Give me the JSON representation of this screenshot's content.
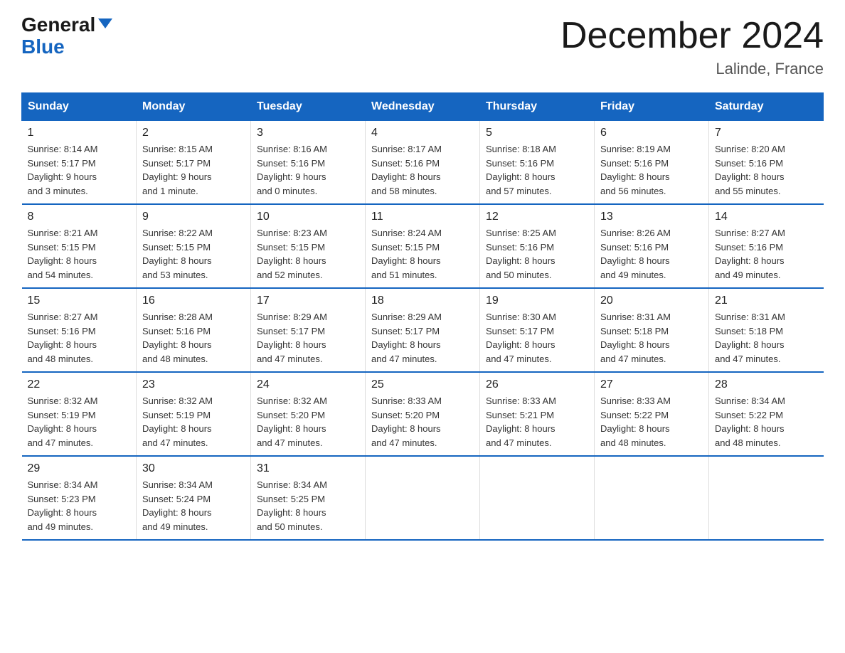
{
  "header": {
    "logo_general": "General",
    "logo_blue": "Blue",
    "month_title": "December 2024",
    "location": "Lalinde, France"
  },
  "days_of_week": [
    "Sunday",
    "Monday",
    "Tuesday",
    "Wednesday",
    "Thursday",
    "Friday",
    "Saturday"
  ],
  "weeks": [
    [
      {
        "day": "1",
        "sunrise": "8:14 AM",
        "sunset": "5:17 PM",
        "daylight": "9 hours and 3 minutes."
      },
      {
        "day": "2",
        "sunrise": "8:15 AM",
        "sunset": "5:17 PM",
        "daylight": "9 hours and 1 minute."
      },
      {
        "day": "3",
        "sunrise": "8:16 AM",
        "sunset": "5:16 PM",
        "daylight": "9 hours and 0 minutes."
      },
      {
        "day": "4",
        "sunrise": "8:17 AM",
        "sunset": "5:16 PM",
        "daylight": "8 hours and 58 minutes."
      },
      {
        "day": "5",
        "sunrise": "8:18 AM",
        "sunset": "5:16 PM",
        "daylight": "8 hours and 57 minutes."
      },
      {
        "day": "6",
        "sunrise": "8:19 AM",
        "sunset": "5:16 PM",
        "daylight": "8 hours and 56 minutes."
      },
      {
        "day": "7",
        "sunrise": "8:20 AM",
        "sunset": "5:16 PM",
        "daylight": "8 hours and 55 minutes."
      }
    ],
    [
      {
        "day": "8",
        "sunrise": "8:21 AM",
        "sunset": "5:15 PM",
        "daylight": "8 hours and 54 minutes."
      },
      {
        "day": "9",
        "sunrise": "8:22 AM",
        "sunset": "5:15 PM",
        "daylight": "8 hours and 53 minutes."
      },
      {
        "day": "10",
        "sunrise": "8:23 AM",
        "sunset": "5:15 PM",
        "daylight": "8 hours and 52 minutes."
      },
      {
        "day": "11",
        "sunrise": "8:24 AM",
        "sunset": "5:15 PM",
        "daylight": "8 hours and 51 minutes."
      },
      {
        "day": "12",
        "sunrise": "8:25 AM",
        "sunset": "5:16 PM",
        "daylight": "8 hours and 50 minutes."
      },
      {
        "day": "13",
        "sunrise": "8:26 AM",
        "sunset": "5:16 PM",
        "daylight": "8 hours and 49 minutes."
      },
      {
        "day": "14",
        "sunrise": "8:27 AM",
        "sunset": "5:16 PM",
        "daylight": "8 hours and 49 minutes."
      }
    ],
    [
      {
        "day": "15",
        "sunrise": "8:27 AM",
        "sunset": "5:16 PM",
        "daylight": "8 hours and 48 minutes."
      },
      {
        "day": "16",
        "sunrise": "8:28 AM",
        "sunset": "5:16 PM",
        "daylight": "8 hours and 48 minutes."
      },
      {
        "day": "17",
        "sunrise": "8:29 AM",
        "sunset": "5:17 PM",
        "daylight": "8 hours and 47 minutes."
      },
      {
        "day": "18",
        "sunrise": "8:29 AM",
        "sunset": "5:17 PM",
        "daylight": "8 hours and 47 minutes."
      },
      {
        "day": "19",
        "sunrise": "8:30 AM",
        "sunset": "5:17 PM",
        "daylight": "8 hours and 47 minutes."
      },
      {
        "day": "20",
        "sunrise": "8:31 AM",
        "sunset": "5:18 PM",
        "daylight": "8 hours and 47 minutes."
      },
      {
        "day": "21",
        "sunrise": "8:31 AM",
        "sunset": "5:18 PM",
        "daylight": "8 hours and 47 minutes."
      }
    ],
    [
      {
        "day": "22",
        "sunrise": "8:32 AM",
        "sunset": "5:19 PM",
        "daylight": "8 hours and 47 minutes."
      },
      {
        "day": "23",
        "sunrise": "8:32 AM",
        "sunset": "5:19 PM",
        "daylight": "8 hours and 47 minutes."
      },
      {
        "day": "24",
        "sunrise": "8:32 AM",
        "sunset": "5:20 PM",
        "daylight": "8 hours and 47 minutes."
      },
      {
        "day": "25",
        "sunrise": "8:33 AM",
        "sunset": "5:20 PM",
        "daylight": "8 hours and 47 minutes."
      },
      {
        "day": "26",
        "sunrise": "8:33 AM",
        "sunset": "5:21 PM",
        "daylight": "8 hours and 47 minutes."
      },
      {
        "day": "27",
        "sunrise": "8:33 AM",
        "sunset": "5:22 PM",
        "daylight": "8 hours and 48 minutes."
      },
      {
        "day": "28",
        "sunrise": "8:34 AM",
        "sunset": "5:22 PM",
        "daylight": "8 hours and 48 minutes."
      }
    ],
    [
      {
        "day": "29",
        "sunrise": "8:34 AM",
        "sunset": "5:23 PM",
        "daylight": "8 hours and 49 minutes."
      },
      {
        "day": "30",
        "sunrise": "8:34 AM",
        "sunset": "5:24 PM",
        "daylight": "8 hours and 49 minutes."
      },
      {
        "day": "31",
        "sunrise": "8:34 AM",
        "sunset": "5:25 PM",
        "daylight": "8 hours and 50 minutes."
      },
      null,
      null,
      null,
      null
    ]
  ]
}
